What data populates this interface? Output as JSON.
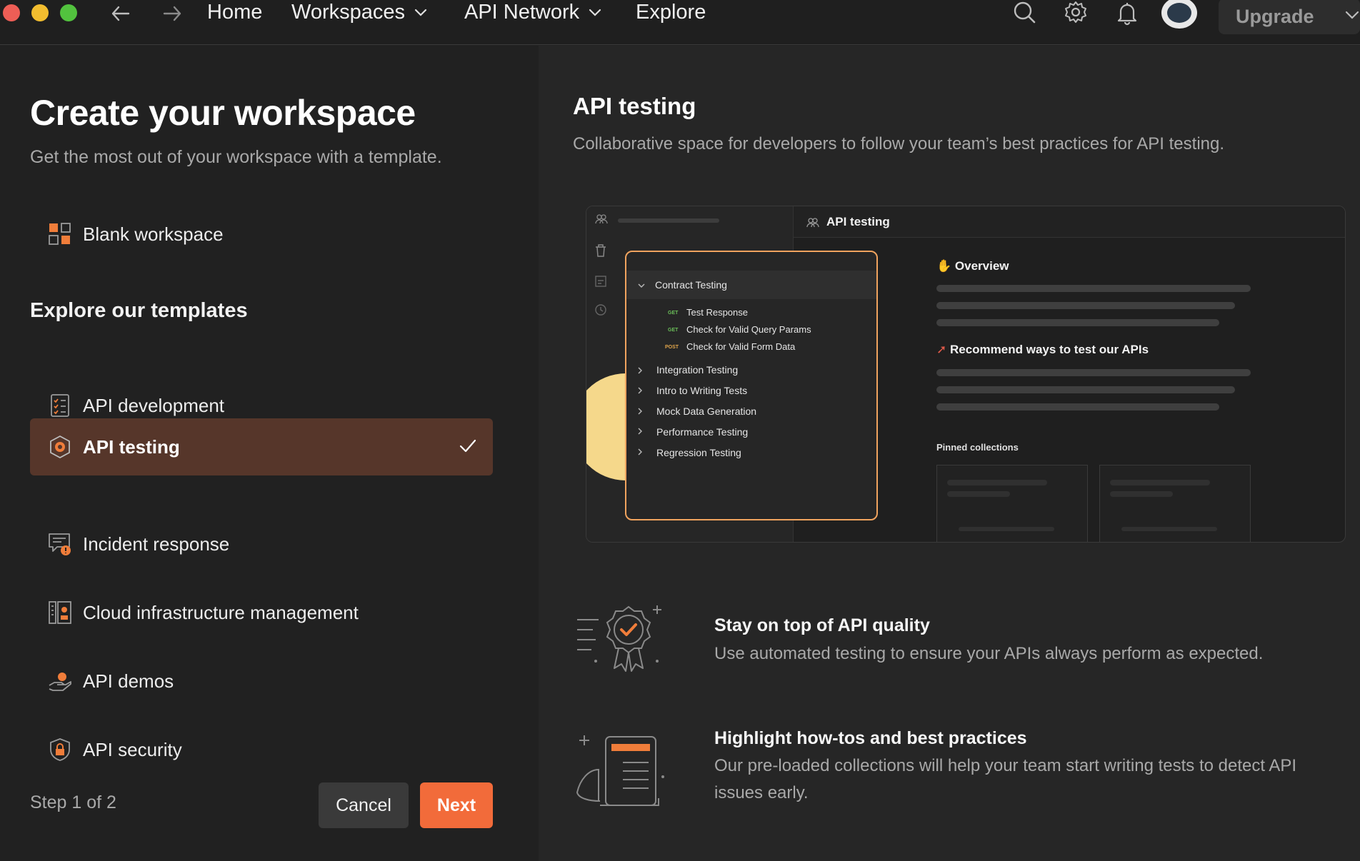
{
  "topbar": {
    "nav": {
      "home": "Home",
      "workspaces": "Workspaces",
      "api_network": "API Network",
      "explore": "Explore"
    },
    "upgrade_label": "Upgrade"
  },
  "left": {
    "title": "Create your workspace",
    "subtitle": "Get the most out of your workspace with a template.",
    "blank_label": "Blank workspace",
    "templates_heading": "Explore our templates",
    "templates": [
      {
        "label": "API development",
        "icon": "checklist-icon",
        "selected": false
      },
      {
        "label": "API testing",
        "icon": "gear-badge-icon",
        "selected": true
      },
      {
        "label": "Incident response",
        "icon": "alert-message-icon",
        "selected": false
      },
      {
        "label": "Cloud infrastructure management",
        "icon": "server-rack-icon",
        "selected": false
      },
      {
        "label": "API demos",
        "icon": "hand-present-icon",
        "selected": false
      },
      {
        "label": "API security",
        "icon": "shield-lock-icon",
        "selected": false
      }
    ],
    "step_text": "Step 1 of 2",
    "cancel_label": "Cancel",
    "next_label": "Next"
  },
  "right": {
    "title": "API testing",
    "description": "Collaborative space for developers to follow your team’s best practices for API testing.",
    "preview": {
      "tab_label": "API testing",
      "tree": {
        "expanded_folder": "Contract Testing",
        "requests": [
          {
            "method": "GET",
            "name": "Test Response"
          },
          {
            "method": "GET",
            "name": "Check for Valid Query Params"
          },
          {
            "method": "POST",
            "name": "Check for Valid Form Data"
          }
        ],
        "folders": [
          "Integration Testing",
          "Intro to Writing Tests",
          "Mock Data Generation",
          "Performance Testing",
          "Regression Testing"
        ]
      },
      "overview_heading": "Overview",
      "recommend_heading": "Recommend ways to test our APIs",
      "pinned_heading": "Pinned collections"
    },
    "features": [
      {
        "title": "Stay on top of API quality",
        "description": "Use automated testing to ensure your APIs always perform as expected.",
        "icon": "quality-badge-icon"
      },
      {
        "title": "Highlight how-tos and best practices",
        "description": "Our pre-loaded collections will help your team start writing tests to detect API issues early.",
        "icon": "document-scroll-icon"
      }
    ]
  },
  "colors": {
    "accent": "#f26b3a",
    "selected_bg": "#56362a",
    "highlight_border": "#f0a35e",
    "sun": "#f5d88b"
  }
}
